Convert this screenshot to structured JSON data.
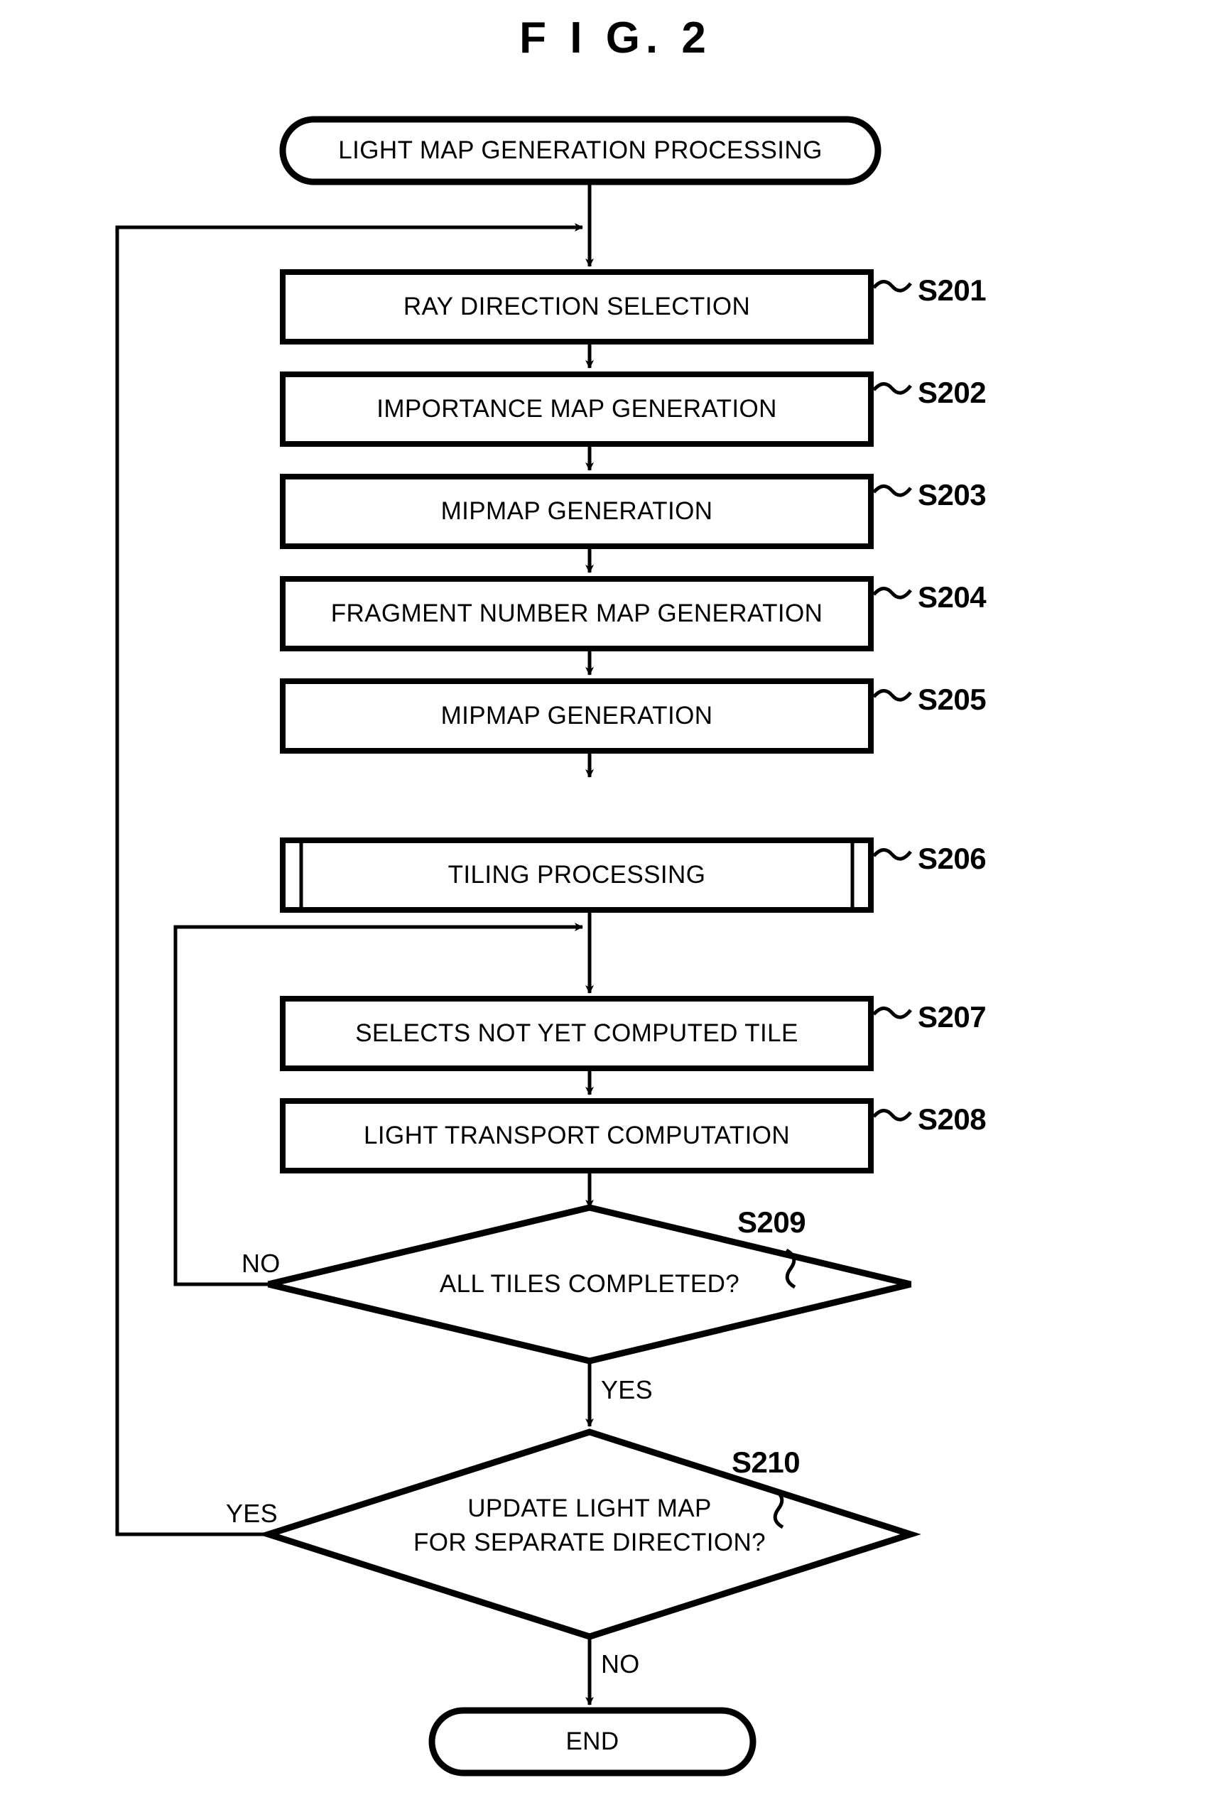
{
  "figure": {
    "title": "F I G.  2"
  },
  "flow": {
    "start": {
      "label": "LIGHT MAP GENERATION PROCESSING"
    },
    "steps": [
      {
        "id": "S201",
        "label": "RAY DIRECTION SELECTION",
        "shape": "process"
      },
      {
        "id": "S202",
        "label": "IMPORTANCE MAP GENERATION",
        "shape": "process"
      },
      {
        "id": "S203",
        "label": "MIPMAP GENERATION",
        "shape": "process"
      },
      {
        "id": "S204",
        "label": "FRAGMENT NUMBER MAP GENERATION",
        "shape": "process"
      },
      {
        "id": "S205",
        "label": "MIPMAP GENERATION",
        "shape": "process"
      },
      {
        "id": "S206",
        "label": "TILING PROCESSING",
        "shape": "predefined-process"
      },
      {
        "id": "S207",
        "label": "SELECTS NOT YET COMPUTED TILE",
        "shape": "process"
      },
      {
        "id": "S208",
        "label": "LIGHT TRANSPORT COMPUTATION",
        "shape": "process"
      }
    ],
    "decisions": [
      {
        "id": "S209",
        "label": "ALL TILES COMPLETED?",
        "line1": "ALL TILES COMPLETED?",
        "line2": ""
      },
      {
        "id": "S210",
        "label": "UPDATE LIGHT MAP FOR SEPARATE DIRECTION?",
        "line1": "UPDATE LIGHT MAP",
        "line2": "FOR SEPARATE DIRECTION?"
      }
    ],
    "end": {
      "label": "END"
    },
    "edge_labels": {
      "s209_no": "NO",
      "s209_yes": "YES",
      "s210_yes": "YES",
      "s210_no": "NO"
    }
  },
  "colors": {
    "stroke": "#000000",
    "background": "#ffffff"
  }
}
